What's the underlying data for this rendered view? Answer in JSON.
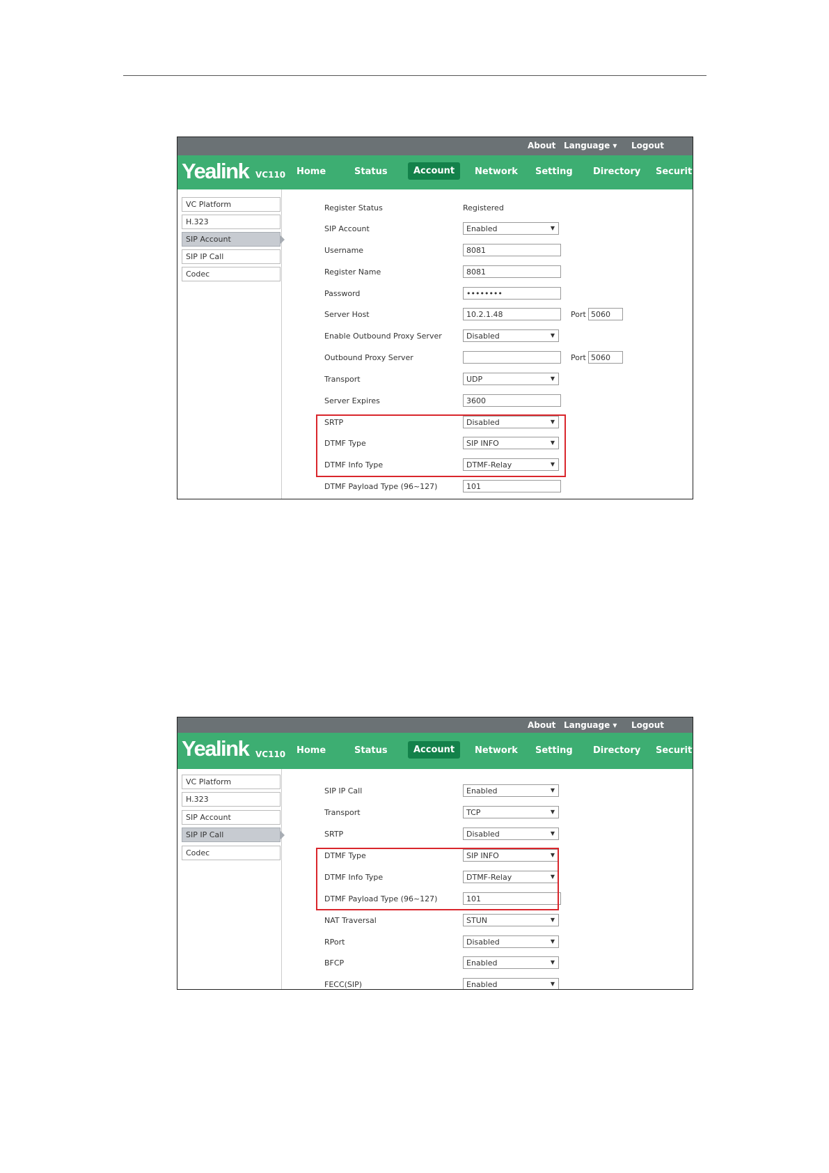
{
  "shot1": {
    "topbar": {
      "about": "About",
      "language": "Language ▾",
      "logout": "Logout"
    },
    "nav": {
      "logo": "Yealink",
      "model": "VC110",
      "home": "Home",
      "status": "Status",
      "account": "Account",
      "network": "Network",
      "setting": "Setting",
      "directory": "Directory",
      "security": "Security"
    },
    "sidebar": [
      "VC Platform",
      "H.323",
      "SIP Account",
      "SIP IP Call",
      "Codec"
    ],
    "rows": {
      "register_status": {
        "label": "Register Status",
        "value": "Registered"
      },
      "sip_account": {
        "label": "SIP Account",
        "value": "Enabled"
      },
      "username": {
        "label": "Username",
        "value": "8081"
      },
      "register_name": {
        "label": "Register Name",
        "value": "8081"
      },
      "password": {
        "label": "Password",
        "value": "••••••••"
      },
      "server_host": {
        "label": "Server Host",
        "value": "10.2.1.48",
        "port_label": "Port",
        "port": "5060"
      },
      "outbound_enable": {
        "label": "Enable Outbound Proxy Server",
        "value": "Disabled"
      },
      "outbound_server": {
        "label": "Outbound Proxy Server",
        "value": "",
        "port_label": "Port",
        "port": "5060"
      },
      "transport": {
        "label": "Transport",
        "value": "UDP"
      },
      "server_expires": {
        "label": "Server Expires",
        "value": "3600"
      },
      "srtp": {
        "label": "SRTP",
        "value": "Disabled"
      },
      "dtmf_type": {
        "label": "DTMF Type",
        "value": "SIP INFO"
      },
      "dtmf_info_type": {
        "label": "DTMF Info Type",
        "value": "DTMF-Relay"
      },
      "dtmf_payload": {
        "label": "DTMF Payload Type (96~127)",
        "value": "101"
      }
    }
  },
  "shot2": {
    "topbar": {
      "about": "About",
      "language": "Language ▾",
      "logout": "Logout"
    },
    "nav": {
      "logo": "Yealink",
      "model": "VC110",
      "home": "Home",
      "status": "Status",
      "account": "Account",
      "network": "Network",
      "setting": "Setting",
      "directory": "Directory",
      "security": "Security"
    },
    "sidebar": [
      "VC Platform",
      "H.323",
      "SIP Account",
      "SIP IP Call",
      "Codec"
    ],
    "rows": {
      "sip_ip_call": {
        "label": "SIP IP Call",
        "value": "Enabled"
      },
      "transport": {
        "label": "Transport",
        "value": "TCP"
      },
      "srtp": {
        "label": "SRTP",
        "value": "Disabled"
      },
      "dtmf_type": {
        "label": "DTMF Type",
        "value": "SIP INFO"
      },
      "dtmf_info_type": {
        "label": "DTMF Info Type",
        "value": "DTMF-Relay"
      },
      "dtmf_payload": {
        "label": "DTMF Payload Type (96~127)",
        "value": "101"
      },
      "nat_traversal": {
        "label": "NAT Traversal",
        "value": "STUN"
      },
      "rport": {
        "label": "RPort",
        "value": "Disabled"
      },
      "bfcp": {
        "label": "BFCP",
        "value": "Enabled"
      },
      "fecc": {
        "label": "FECC(SIP)",
        "value": "Enabled"
      }
    }
  },
  "colors": {
    "nav_green": "#3dae72",
    "active_tab": "#13814a",
    "topbar_gray": "#6b7275",
    "highlight_red": "#d9262c"
  }
}
